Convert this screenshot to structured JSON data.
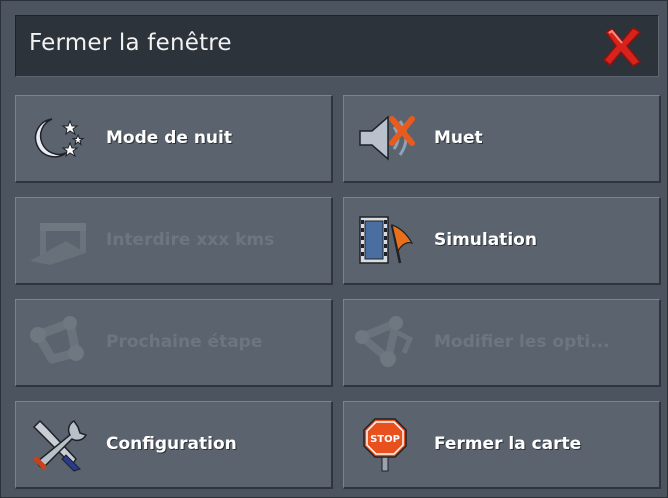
{
  "window": {
    "title": "Fermer la fenêtre",
    "close_icon": "close-x-icon"
  },
  "menu": [
    {
      "label": "Mode de nuit",
      "icon": "night-mode-icon",
      "enabled": true
    },
    {
      "label": "Muet",
      "icon": "mute-speaker-icon",
      "enabled": true
    },
    {
      "label": "Interdire xxx kms",
      "icon": "barrier-icon",
      "enabled": false
    },
    {
      "label": "Simulation",
      "icon": "simulation-film-flag-icon",
      "enabled": true
    },
    {
      "label": "Prochaine étape",
      "icon": "route-waypoint-icon",
      "enabled": false
    },
    {
      "label": "Modifier les opti...",
      "icon": "route-options-icon",
      "enabled": false
    },
    {
      "label": "Configuration",
      "icon": "tools-wrench-screwdriver-icon",
      "enabled": true
    },
    {
      "label": "Fermer la carte",
      "icon": "stop-sign-icon",
      "enabled": true
    }
  ],
  "colors": {
    "background": "#4b545f",
    "button": "#5b636e",
    "titlebar": "#2c333b",
    "close_red": "#d8231c",
    "disabled_text": "#6d767f"
  }
}
